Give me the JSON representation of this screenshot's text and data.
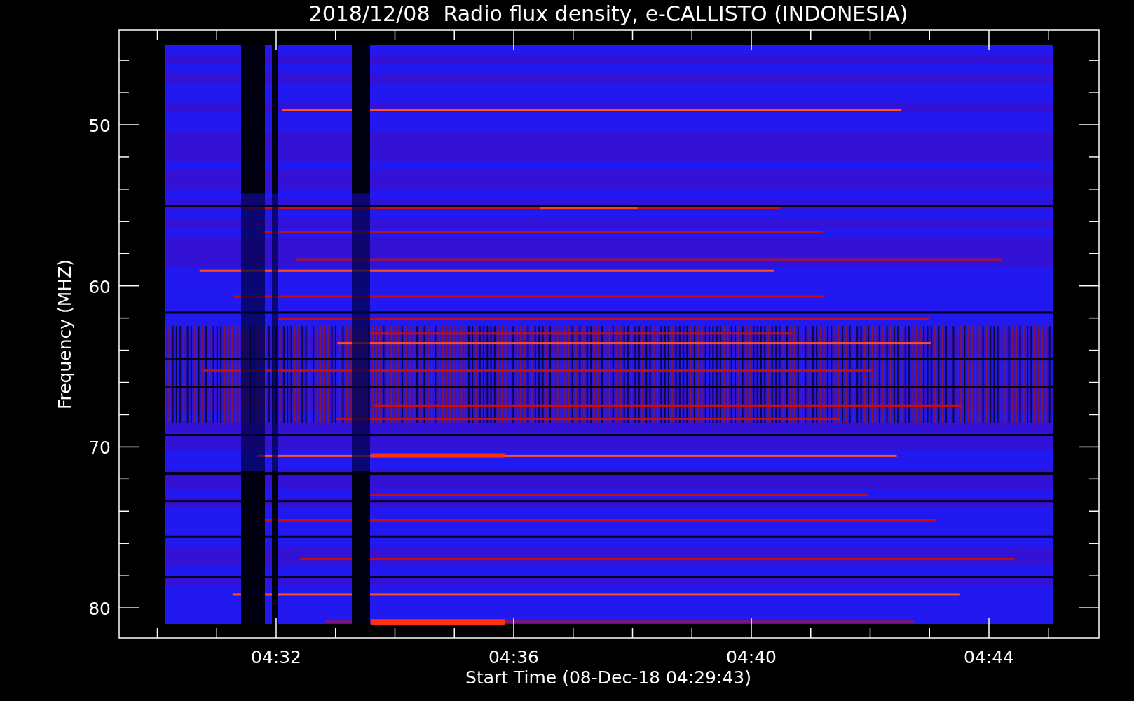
{
  "title": "2018/12/08  Radio flux density, e-CALLISTO (INDONESIA)",
  "ylabel": "Frequency (MHZ)",
  "xlabel": "Start Time (08-Dec-18 04:29:43)",
  "yticks": [
    "50",
    "60",
    "70",
    "80"
  ],
  "xticks": [
    "04:32",
    "04:36",
    "04:40",
    "04:44"
  ]
}
